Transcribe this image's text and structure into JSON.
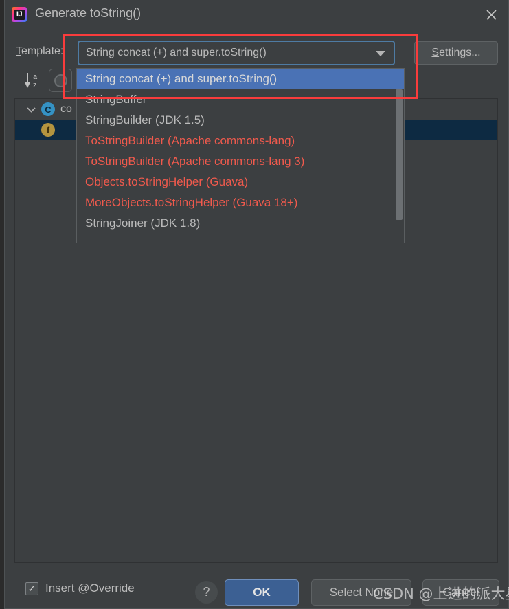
{
  "window": {
    "title": "Generate toString()",
    "app_icon": "intellij-idea-icon",
    "app_icon_glyph": "IJ",
    "close_icon": "close-icon"
  },
  "template_row": {
    "label_prefix": "",
    "label_mnemonic": "T",
    "label_rest": "emplate:",
    "combo_value": "String concat (+) and super.toString()",
    "settings_mnemonic": "S",
    "settings_rest": "ettings..."
  },
  "toolbar": {
    "sort_icon": "sort-alphabetical-icon",
    "sort_letters": [
      "a",
      "z"
    ],
    "filter_icon": "filter-circle-icon"
  },
  "dropdown": {
    "open": true,
    "items": [
      {
        "label": "String concat (+) and super.toString()",
        "selected": true,
        "style": "normal"
      },
      {
        "label": "StringBuffer",
        "selected": false,
        "style": "normal"
      },
      {
        "label": "StringBuilder (JDK 1.5)",
        "selected": false,
        "style": "normal"
      },
      {
        "label": "ToStringBuilder (Apache commons-lang)",
        "selected": false,
        "style": "accent"
      },
      {
        "label": "ToStringBuilder (Apache commons-lang 3)",
        "selected": false,
        "style": "accent"
      },
      {
        "label": "Objects.toStringHelper (Guava)",
        "selected": false,
        "style": "accent"
      },
      {
        "label": "MoreObjects.toStringHelper (Guava 18+)",
        "selected": false,
        "style": "accent"
      },
      {
        "label": "StringJoiner (JDK 1.8)",
        "selected": false,
        "style": "normal"
      }
    ],
    "selected_color": "#4a72b5",
    "accent_color": "#f05a4d"
  },
  "tree": {
    "rows": [
      {
        "label": "co",
        "icon": "class-icon",
        "icon_letter": "C",
        "expanded": true,
        "selected": false,
        "indent": 0
      },
      {
        "label": "",
        "icon": "field-icon",
        "icon_letter": "f",
        "expanded": false,
        "selected": true,
        "indent": 1
      }
    ],
    "selected_row_color": "#0d2a42"
  },
  "annotation": {
    "type": "highlight-rectangle",
    "color": "#fa3c3c"
  },
  "bottom_bar": {
    "checkbox_checked": true,
    "checkbox_check_glyph": "✓",
    "checkbox_label_prefix": "Insert @",
    "checkbox_label_mnemonic": "O",
    "checkbox_label_rest": "verride",
    "help_label": "?",
    "ok_label": "OK",
    "select_none_label": "Select None",
    "cancel_label": "Cancel",
    "ok_color": "#3c6093"
  },
  "watermark": {
    "text": "CSDN @上进的派大星"
  }
}
